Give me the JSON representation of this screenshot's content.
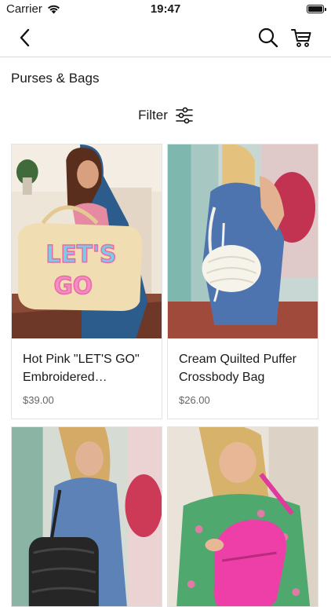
{
  "status_bar": {
    "carrier": "Carrier",
    "time": "19:47"
  },
  "nav": {
    "icons": [
      "back-chevron-icon",
      "search-icon",
      "cart-icon"
    ]
  },
  "page": {
    "title": "Purses & Bags"
  },
  "filter": {
    "label": "Filter",
    "icon": "sliders-icon"
  },
  "products": [
    {
      "name": "Hot Pink \"LET'S GO\" Embroidered Weekender Bag",
      "price": "$39.00",
      "bag_text": "LET'S GO"
    },
    {
      "name": "Cream Quilted Puffer Crossbody Bag",
      "price": "$26.00"
    },
    {
      "name": "",
      "price": ""
    },
    {
      "name": "",
      "price": ""
    }
  ]
}
